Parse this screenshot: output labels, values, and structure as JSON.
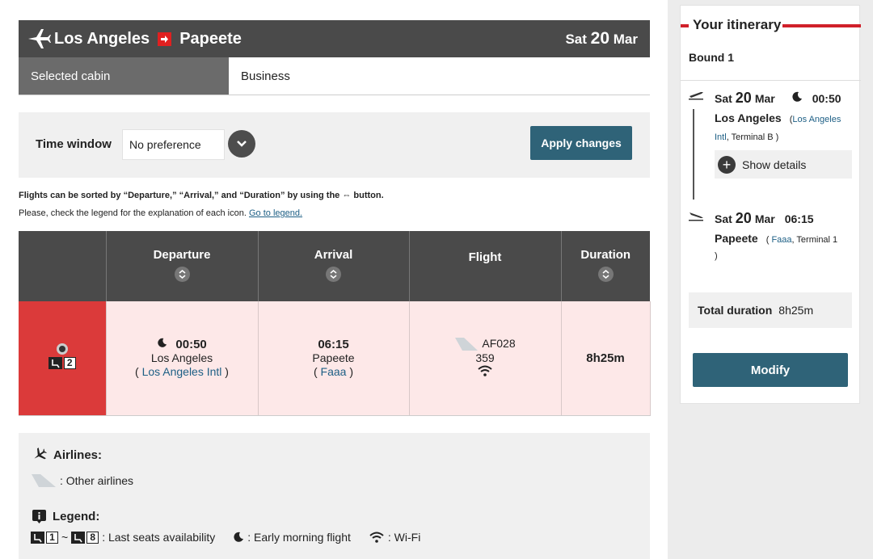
{
  "route": {
    "from": "Los Angeles",
    "to": "Papeete",
    "date_weekday": "Sat",
    "date_day": "20",
    "date_month": "Mar"
  },
  "cabin": {
    "label": "Selected cabin",
    "value": "Business"
  },
  "time_window": {
    "label": "Time window",
    "selected": "No preference",
    "apply_label": "Apply changes"
  },
  "notes": {
    "sort": "Flights can be sorted by “Departure,” “Arrival,” and “Duration” by using the ⇔ button.",
    "legend_text": "Please, check the legend for the explanation of each icon.",
    "legend_link": "Go to legend."
  },
  "table": {
    "headers": [
      "Departure",
      "Arrival",
      "Flight",
      "Duration"
    ],
    "row": {
      "seats_left": "2",
      "dep_time": "00:50",
      "dep_city": "Los Angeles",
      "dep_airport": "Los Angeles Intl",
      "arr_time": "06:15",
      "arr_city": "Papeete",
      "arr_airport": "Faaa",
      "flight_no": "AF028",
      "aircraft": "359",
      "duration": "8h25m"
    }
  },
  "legend": {
    "airlines_heading": "Airlines:",
    "other_airlines": ": Other airlines",
    "legend_heading": "Legend:",
    "seat_from": "1",
    "seat_to": "8",
    "tilde": "~",
    "seats_text": ": Last seats availability",
    "morning_text": ": Early morning flight",
    "wifi_text": ": Wi-Fi"
  },
  "itinerary": {
    "title": "Your itinerary",
    "bound": "Bound 1",
    "dep": {
      "weekday": "Sat",
      "day": "20",
      "month": "Mar",
      "time": "00:50",
      "city": "Los Angeles",
      "airport": "Los Angeles Intl",
      "terminal": ", Terminal B )"
    },
    "show_details": "Show details",
    "arr": {
      "weekday": "Sat",
      "day": "20",
      "month": "Mar",
      "time": "06:15",
      "city": "Papeete",
      "airport": "Faaa",
      "terminal": ", Terminal 1"
    },
    "total_label": "Total duration",
    "total_value": "8h25m",
    "modify_label": "Modify"
  },
  "colors": {
    "accent": "#2f6378",
    "brand_red": "#d0202a",
    "header_gray": "#4a4a4a",
    "row_pink": "#fde8e8"
  }
}
